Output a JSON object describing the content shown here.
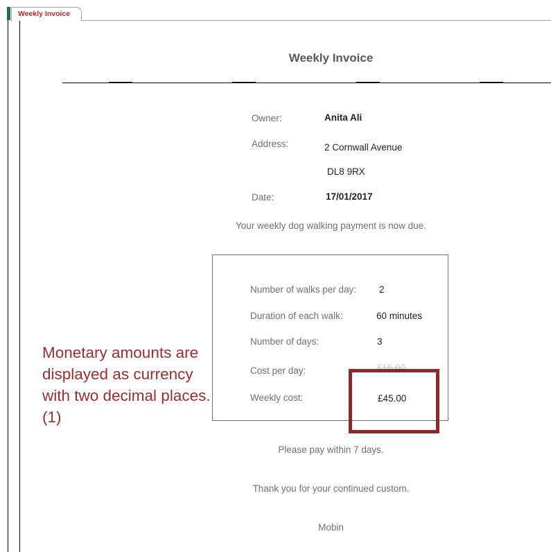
{
  "window": {
    "tab_label": "Weekly Invoice"
  },
  "report": {
    "title": "Weekly Invoice",
    "owner_label": "Owner:",
    "owner_value": "Anita Ali",
    "address_label": "Address:",
    "address_line1": "2 Cornwall Avenue",
    "address_line2": "DL8 9RX",
    "date_label": "Date:",
    "date_value": "17/01/2017",
    "payment_due_message": "Your weekly dog walking payment is now due.",
    "details": {
      "walks_per_day_label": "Number of walks per day:",
      "walks_per_day_value": "2",
      "duration_label": "Duration of each walk:",
      "duration_value": "60",
      "duration_unit": "minutes",
      "days_label": "Number of days:",
      "days_value": "3",
      "cost_per_day_label": "Cost per day:",
      "cost_per_day_value": "£15.00",
      "weekly_cost_label": "Weekly cost:",
      "weekly_cost_value": "£45.00"
    },
    "pay_within_message": "Please pay within 7 days.",
    "thank_you_message": "Thank you for your continued custom.",
    "signature": "Mobin"
  },
  "annotation": {
    "lines": [
      "Monetary amounts are",
      "displayed as currency",
      "with two decimal places.",
      "(1)"
    ],
    "color": "#9b2d30"
  },
  "colors": {
    "highlight_border": "#8b2a2e",
    "tab_text": "#b52a2a"
  }
}
